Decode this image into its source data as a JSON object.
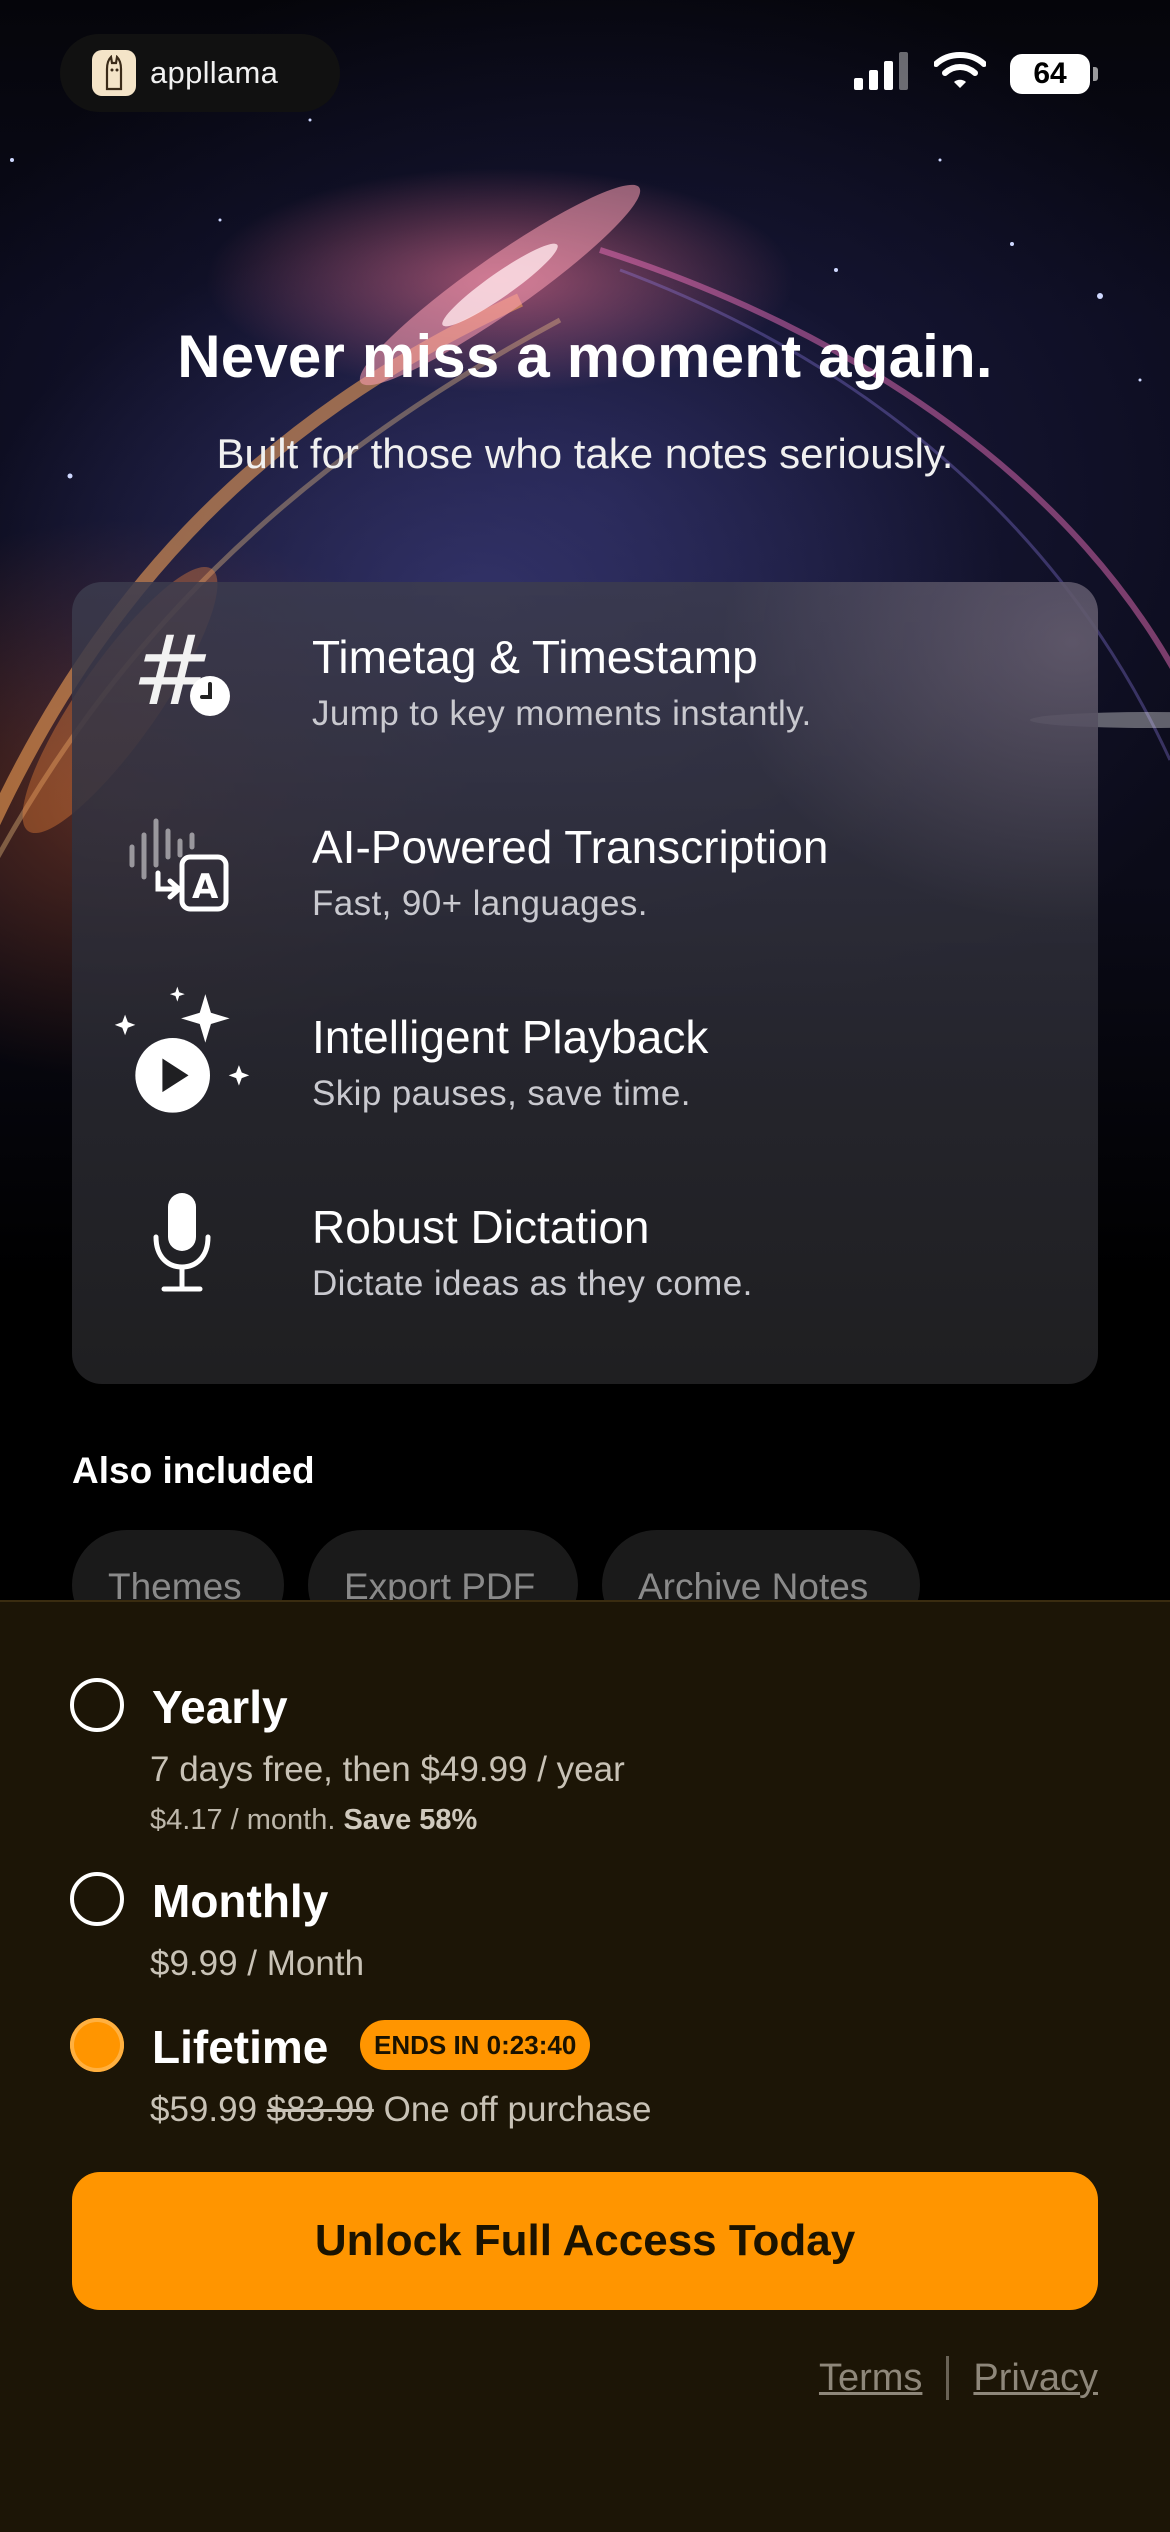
{
  "status_bar": {
    "brand_name": "appllama",
    "battery_level": "64",
    "icons": [
      "signal-icon",
      "wifi-icon",
      "battery-icon"
    ]
  },
  "hero": {
    "title": "Never miss a moment again.",
    "subtitle": "Built for those who take notes seriously."
  },
  "features": [
    {
      "icon": "hashtag-clock-icon",
      "title": "Timetag & Timestamp",
      "description": "Jump to key moments instantly."
    },
    {
      "icon": "transcription-icon",
      "title": "AI-Powered Transcription",
      "description": "Fast, 90+ languages."
    },
    {
      "icon": "sparkle-play-icon",
      "title": "Intelligent Playback",
      "description": "Skip pauses, save time."
    },
    {
      "icon": "microphone-icon",
      "title": "Robust Dictation",
      "description": "Dictate ideas as they come."
    }
  ],
  "also_included": {
    "label": "Also included",
    "chips": [
      "Themes",
      "Export PDF",
      "Archive Notes"
    ]
  },
  "plans": {
    "yearly": {
      "name": "Yearly",
      "line": "7 days free, then $49.99 / year",
      "sub_price": "$4.17 / month.",
      "sub_save": "Save 58%",
      "selected": false
    },
    "monthly": {
      "name": "Monthly",
      "line": "$9.99 / Month",
      "selected": false
    },
    "lifetime": {
      "name": "Lifetime",
      "badge": "ENDS IN 0:23:40",
      "price": "$59.99",
      "old_price": "$83.99",
      "note": "One off purchase",
      "selected": true
    }
  },
  "cta": {
    "label": "Unlock Full Access Today"
  },
  "footer": {
    "terms": "Terms",
    "privacy": "Privacy"
  },
  "colors": {
    "accent": "#ff9500",
    "sheet_bg": "#1c1506"
  }
}
